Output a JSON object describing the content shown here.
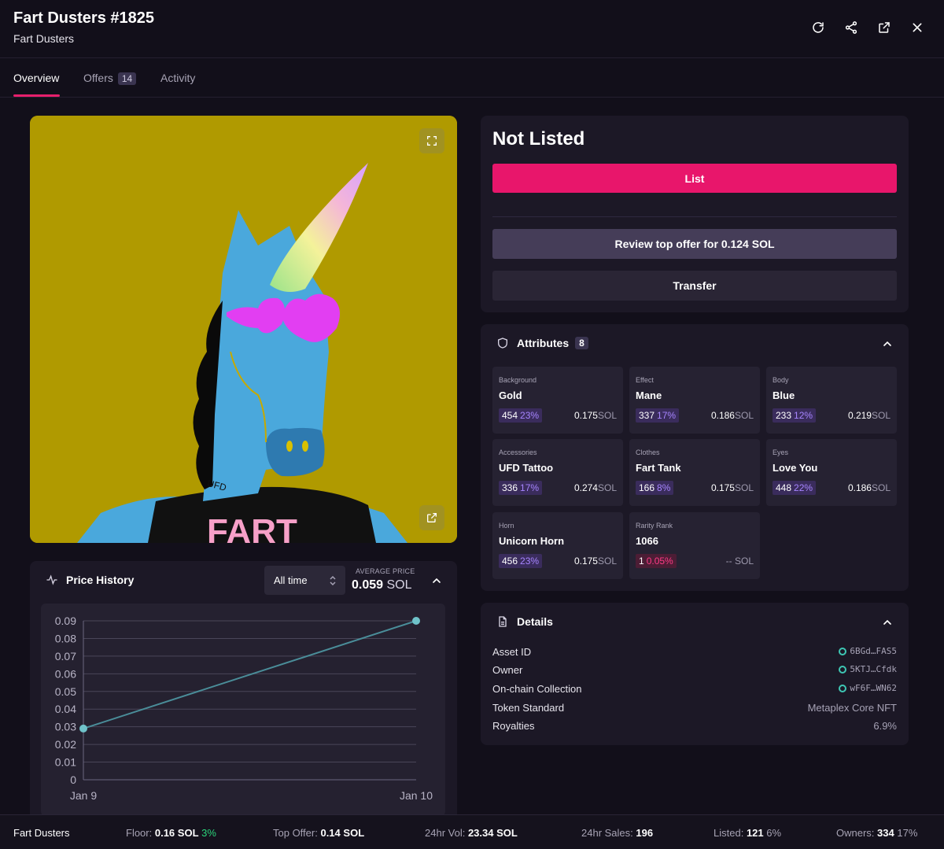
{
  "header": {
    "title": "Fart Dusters #1825",
    "subtitle": "Fart Dusters",
    "icons": [
      "refresh-icon",
      "share-icon",
      "external-link-icon",
      "close-icon"
    ]
  },
  "tabs": [
    {
      "label": "Overview",
      "active": true
    },
    {
      "label": "Offers",
      "badge": "14"
    },
    {
      "label": "Activity"
    }
  ],
  "listing": {
    "status": "Not Listed",
    "list_label": "List",
    "offer_label": "Review top offer for 0.124 SOL",
    "transfer_label": "Transfer"
  },
  "attributes": {
    "title": "Attributes",
    "count": "8",
    "items": [
      {
        "type": "Background",
        "value": "Gold",
        "count": "454",
        "pct": "23%",
        "price": "0.175",
        "unit": "SOL"
      },
      {
        "type": "Effect",
        "value": "Mane",
        "count": "337",
        "pct": "17%",
        "price": "0.186",
        "unit": "SOL"
      },
      {
        "type": "Body",
        "value": "Blue",
        "count": "233",
        "pct": "12%",
        "price": "0.219",
        "unit": "SOL"
      },
      {
        "type": "Accessories",
        "value": "UFD Tattoo",
        "count": "336",
        "pct": "17%",
        "price": "0.274",
        "unit": "SOL"
      },
      {
        "type": "Clothes",
        "value": "Fart Tank",
        "count": "166",
        "pct": "8%",
        "price": "0.175",
        "unit": "SOL"
      },
      {
        "type": "Eyes",
        "value": "Love You",
        "count": "448",
        "pct": "22%",
        "price": "0.186",
        "unit": "SOL"
      },
      {
        "type": "Horn",
        "value": "Unicorn Horn",
        "count": "456",
        "pct": "23%",
        "price": "0.175",
        "unit": "SOL"
      },
      {
        "type": "Rarity Rank",
        "value": "1066",
        "count": "1",
        "pct": "0.05%",
        "price": "--",
        "unit": "SOL"
      }
    ]
  },
  "details": {
    "title": "Details",
    "rows": [
      {
        "key": "Asset ID",
        "value": "6BGd…FAS5"
      },
      {
        "key": "Owner",
        "value": "5KTJ…Cfdk"
      },
      {
        "key": "On-chain Collection",
        "value": "wF6F…WN62"
      },
      {
        "key": "Token Standard",
        "value": "Metaplex Core NFT"
      },
      {
        "key": "Royalties",
        "value": "6.9%"
      }
    ]
  },
  "price_history": {
    "title": "Price History",
    "range": "All time",
    "avg_label": "AVERAGE PRICE",
    "avg_value": "0.059",
    "avg_unit": "SOL"
  },
  "chart_data": {
    "type": "line",
    "categories": [
      "Jan 9",
      "Jan 10"
    ],
    "values": [
      0.029,
      0.09
    ],
    "ylim": [
      0,
      0.09
    ],
    "yticks": [
      "0",
      "0.01",
      "0.02",
      "0.03",
      "0.04",
      "0.05",
      "0.06",
      "0.07",
      "0.08",
      "0.09"
    ],
    "grid": true,
    "line_color": "#4a8d99",
    "marker_color": "#6fc2c9"
  },
  "footer": {
    "collection": "Fart Dusters",
    "floor_label": "Floor:",
    "floor_value": "0.16",
    "floor_unit": "SOL",
    "floor_change": "3%",
    "top_offer_label": "Top Offer:",
    "top_offer_value": "0.14",
    "top_offer_unit": "SOL",
    "vol_label": "24hr Vol:",
    "vol_value": "23.34",
    "vol_unit": "SOL",
    "sales_label": "24hr Sales:",
    "sales_value": "196",
    "listed_label": "Listed:",
    "listed_value": "121",
    "listed_pct": "6%",
    "owners_label": "Owners:",
    "owners_value": "334",
    "owners_pct": "17%"
  },
  "colors": {
    "accent": "#e8166b",
    "background": "#120f1a",
    "panel": "#1c1826",
    "positive": "#2bd47a"
  }
}
